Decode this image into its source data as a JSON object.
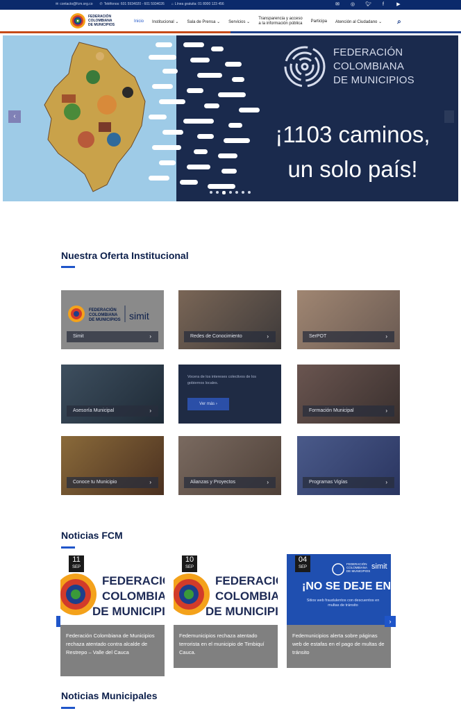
{
  "topbar": {
    "email": "contacto@fcm.org.co",
    "phones": "Teléfonos: 601 5934020 - 601 5934026",
    "address": "Línea gratuita: 01 8000 123 456",
    "social": [
      "mail-icon",
      "instagram-icon",
      "twitter-icon",
      "facebook-icon",
      "youtube-icon"
    ]
  },
  "header": {
    "logo_text": "FEDERACIÓN COLOMBIANA DE MUNICIPIOS",
    "nav": [
      {
        "label": "Inicio",
        "active": true,
        "dropdown": false
      },
      {
        "label": "Institucional",
        "active": false,
        "dropdown": true
      },
      {
        "label": "Sala de Prensa",
        "active": false,
        "dropdown": true
      },
      {
        "label": "Servicios",
        "active": false,
        "dropdown": true
      },
      {
        "label": "Transparencia y acceso",
        "label2": "a la información pública",
        "active": false,
        "dropdown": false
      },
      {
        "label": "Participa",
        "active": false,
        "dropdown": false
      },
      {
        "label": "Atención al Ciudadano",
        "active": false,
        "dropdown": true
      }
    ]
  },
  "hero": {
    "org_line1": "FEDERACIÓN",
    "org_line2": "COLOMBIANA",
    "org_line3": "DE MUNICIPIOS",
    "slogan_line1": "¡1103 caminos,",
    "slogan_line2": "un solo país!",
    "dot_count": 7,
    "active_dot": 2
  },
  "offer": {
    "title": "Nuestra Oferta Institucional",
    "cards": [
      {
        "label": "Simit",
        "bg": "#8a8a8a"
      },
      {
        "label": "Redes de Conocimiento",
        "bg": "#5c4a3e"
      },
      {
        "label": "SerPOT",
        "bg": "#8c7766"
      },
      {
        "label": "Asesoría Municipal",
        "bg": "#2e3f4f"
      },
      {
        "label": "Formación Municipal",
        "bg": "#5a4a45"
      },
      {
        "label": "Conoce tu Municipio",
        "bg": "#6a4a26"
      },
      {
        "label": "Alianzas y Proyectos",
        "bg": "#6b5a50"
      },
      {
        "label": "Programas Vigías",
        "bg": "#3c4a78"
      }
    ],
    "highlight_text": "Vocera de los intereses colectivos de los gobiernos locales.",
    "see_more": "Ver más"
  },
  "news": {
    "title": "Noticias FCM",
    "items": [
      {
        "day": "11",
        "month": "SEP",
        "text": "Federación Colombiana de Municipios rechaza atentado contra alcalde de Restrepo – Valle del Cauca"
      },
      {
        "day": "10",
        "month": "SEP",
        "text": "Fedemunicipios rechaza atentado terrorista en el municipio de Timbiquí Cauca."
      },
      {
        "day": "04",
        "month": "SEP",
        "text": "Fedemunicipios alerta sobre páginas web de estafas en el pago de multas de tránsito"
      }
    ],
    "banner_word1": "FEDERACIÓN",
    "banner_word2": "COLOMBIANA",
    "banner_word3": "DE MUNICIPIOS",
    "alert_text": "¡NO SE DEJE EN",
    "alert_sub": "Sitios web fraudulentos con descuentos en multas de tránsito",
    "simit": "simit"
  },
  "municipal": {
    "title": "Noticias Municipales"
  },
  "colors": {
    "brand_blue": "#0b2a6b",
    "accent_orange": "#c64a18",
    "link_blue": "#1f55c9"
  }
}
